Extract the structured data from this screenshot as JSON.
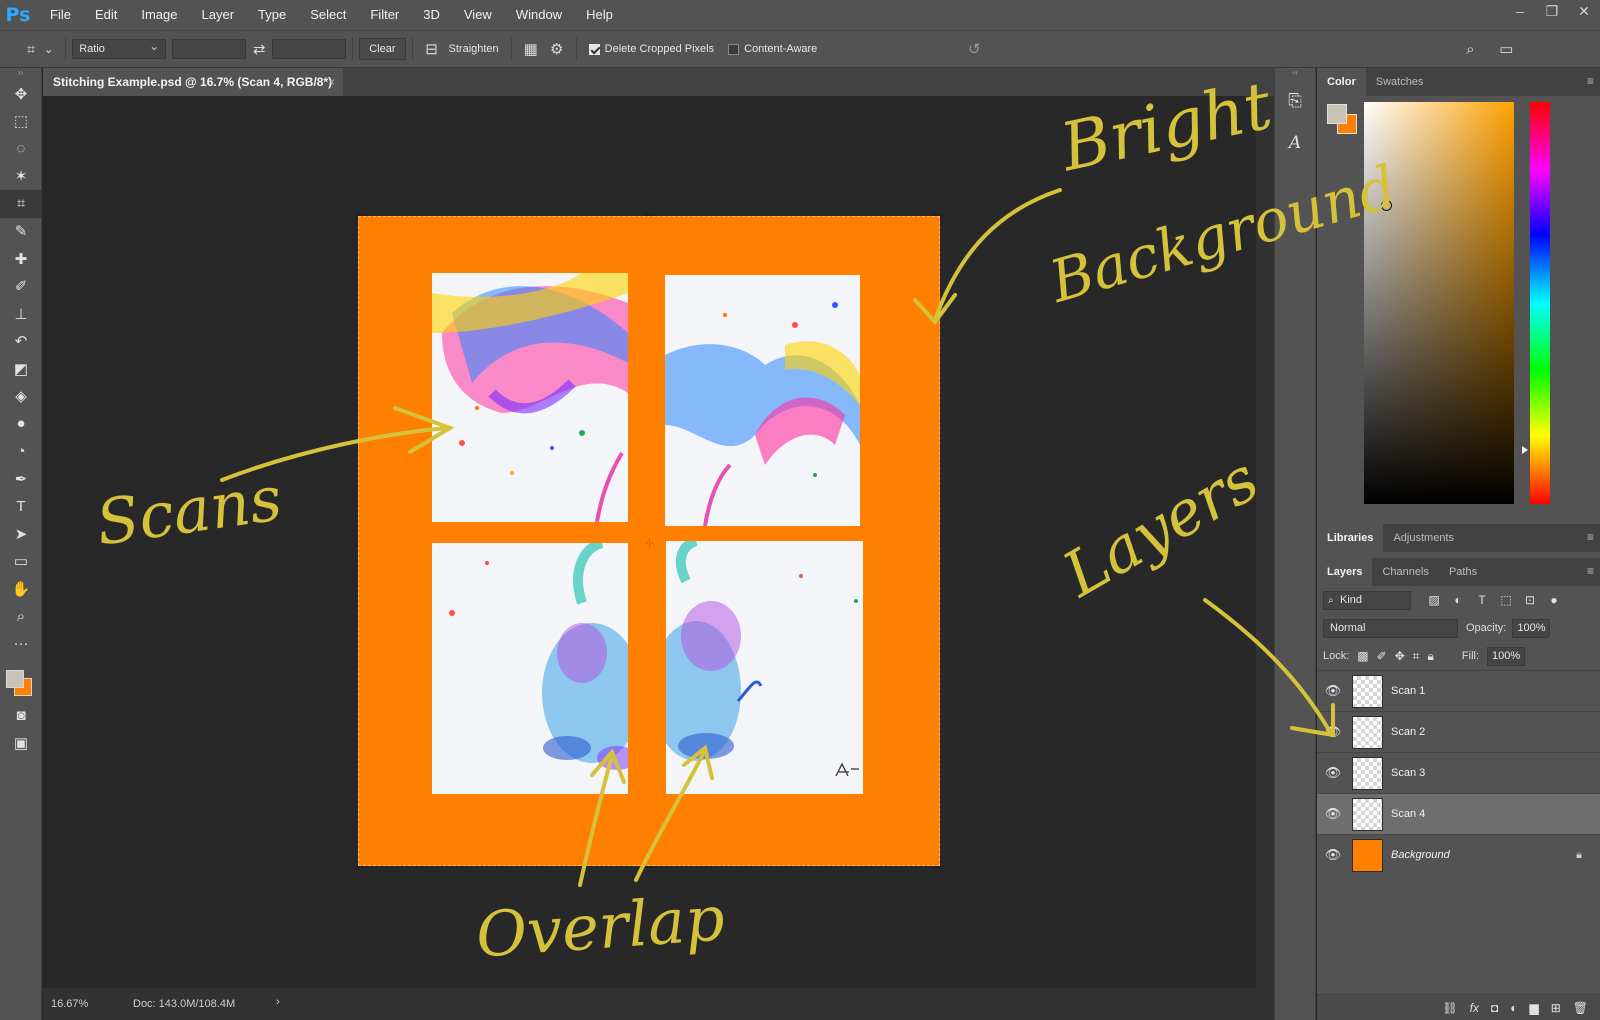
{
  "app": {
    "logo": "Ps"
  },
  "menu": [
    "File",
    "Edit",
    "Image",
    "Layer",
    "Type",
    "Select",
    "Filter",
    "3D",
    "View",
    "Window",
    "Help"
  ],
  "window_controls": [
    "–",
    "❐",
    "✕"
  ],
  "options_bar": {
    "ratio_label": "Ratio",
    "clear_label": "Clear",
    "straighten_label": "Straighten",
    "delete_cropped_label": "Delete Cropped Pixels",
    "delete_cropped_checked": true,
    "content_aware_label": "Content-Aware",
    "content_aware_checked": false
  },
  "document": {
    "tab_title": "Stitching Example.psd @ 16.7% (Scan 4, RGB/8*)",
    "tab_close": "×",
    "background_color": "#ff7f00"
  },
  "status": {
    "zoom": "16.67%",
    "doc_size": "Doc: 143.0M/108.4M",
    "chevron": "›"
  },
  "annotations": {
    "bright_line1": "Bright",
    "bright_line2": "Background",
    "scans": "Scans",
    "overlap": "Overlap",
    "layers": "Layers",
    "color": "#d6c23a"
  },
  "color_panel": {
    "tabs": [
      "Color",
      "Swatches"
    ],
    "foreground": "#c9c3b7",
    "background": "#ff7f00"
  },
  "libraries_tabs": [
    "Libraries",
    "Adjustments"
  ],
  "layers_panel": {
    "tabs": [
      "Layers",
      "Channels",
      "Paths"
    ],
    "kind_label": "Kind",
    "blend_mode": "Normal",
    "opacity_label": "Opacity:",
    "opacity_value": "100%",
    "lock_label": "Lock:",
    "fill_label": "Fill:",
    "fill_value": "100%",
    "layers": [
      {
        "name": "Scan 1",
        "selected": false
      },
      {
        "name": "Scan 2",
        "selected": false
      },
      {
        "name": "Scan 3",
        "selected": false
      },
      {
        "name": "Scan 4",
        "selected": true
      },
      {
        "name": "Background",
        "selected": false,
        "locked": true
      }
    ]
  }
}
